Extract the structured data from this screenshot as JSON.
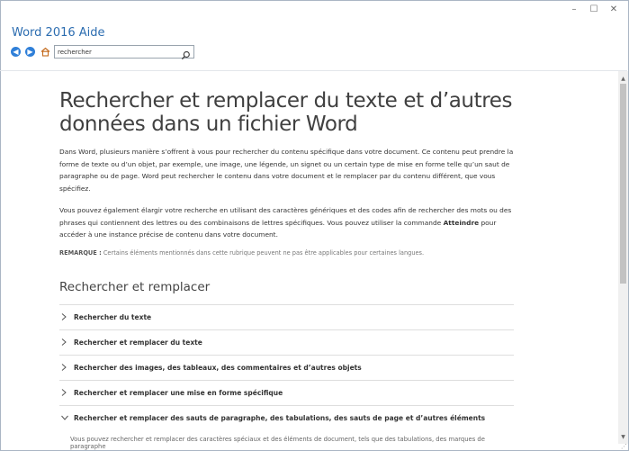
{
  "window": {
    "title": "Word 2016 Aide",
    "controls": {
      "minimize": "–",
      "maximize": "☐",
      "close": "✕"
    }
  },
  "toolbar": {
    "search_value": "rechercher"
  },
  "article": {
    "title": "Rechercher et remplacer du texte et d’autres données dans un fichier Word",
    "para1": "Dans Word, plusieurs manière s’offrent à vous pour rechercher du contenu spécifique dans votre document. Ce contenu peut prendre la forme de texte ou d’un objet, par exemple, une image, une légende, un signet ou un certain type de mise en forme telle qu’un saut de paragraphe ou de page. Word peut rechercher le contenu dans votre document et le remplacer par du contenu différent, que vous spécifiez.",
    "para2_before": "Vous pouvez également élargir votre recherche en utilisant des caractères génériques et des codes afin de rechercher des mots ou des phrases qui contiennent des lettres ou des combinaisons de lettres spécifiques. Vous pouvez utiliser la commande ",
    "para2_bold": "Atteindre",
    "para2_after": " pour accéder à une instance précise de contenu dans votre document.",
    "note_label": "REMARQUE :",
    "note_text": " Certains éléments mentionnés dans cette rubrique peuvent ne pas être applicables pour certaines langues.",
    "section_title": "Rechercher et remplacer",
    "accordion": [
      "Rechercher du texte",
      "Rechercher et remplacer du texte",
      "Rechercher des images, des tableaux, des commentaires et d’autres objets",
      "Rechercher et remplacer une mise en forme spécifique",
      "Rechercher et remplacer des sauts de paragraphe, des tabulations, des sauts de page et d’autres éléments"
    ],
    "open_body": "Vous pouvez rechercher et remplacer des caractères spéciaux et des éléments de document, tels que des tabulations, des marques de paragraphe"
  },
  "icons": {
    "back": "back-arrow-icon",
    "forward": "forward-arrow-icon",
    "home": "home-icon",
    "search": "magnifier-icon"
  },
  "colors": {
    "accent": "#2f7fd8",
    "title": "#2b6cb0"
  }
}
